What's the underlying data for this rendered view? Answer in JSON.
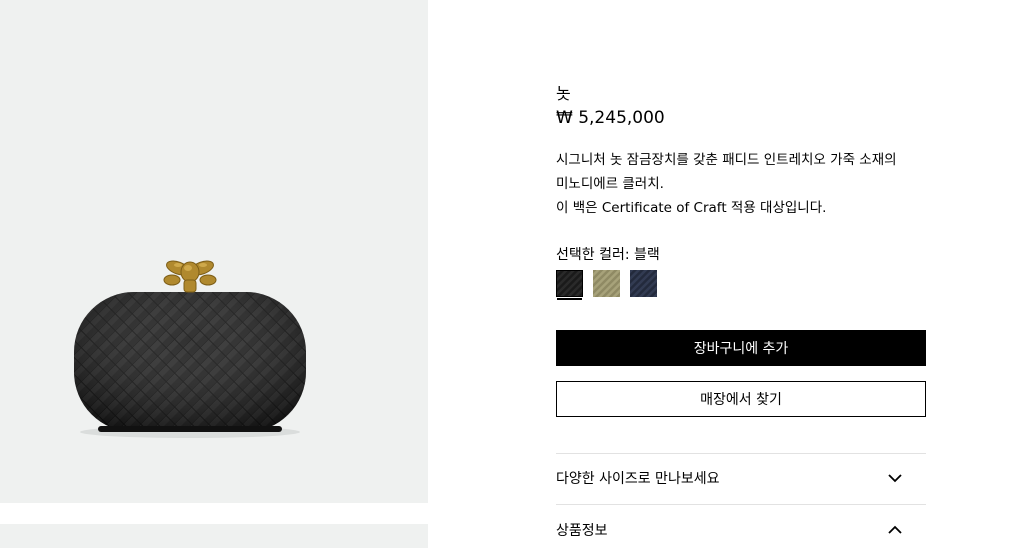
{
  "product": {
    "name": "놋",
    "price": "₩ 5,245,000",
    "description": [
      "시그니처 놋 잠금장치를 갖춘 패디드 인트레치오 가죽 소재의",
      "미노디에르 클러치.",
      "이 백은 Certificate of Craft 적용 대상입니다."
    ],
    "color_label": "선택한 컬러: 블랙",
    "colors": [
      {
        "name": "블랙",
        "hex": "#1a1a1a",
        "selected": true
      },
      {
        "name": "olive",
        "hex": "#a7a27a",
        "selected": false
      },
      {
        "name": "navy",
        "hex": "#232a3c",
        "selected": false
      }
    ]
  },
  "actions": {
    "add_to_cart": "장바구니에 추가",
    "find_in_store": "매장에서 찾기"
  },
  "accordions": [
    {
      "label": "다양한 사이즈로 만나보세요",
      "icon": "chevron-down-icon"
    },
    {
      "label": "상품정보",
      "icon": "chevron-up-icon"
    }
  ],
  "colors": {
    "gallery_bg": "#eff1f0",
    "primary_button": "#000000"
  }
}
